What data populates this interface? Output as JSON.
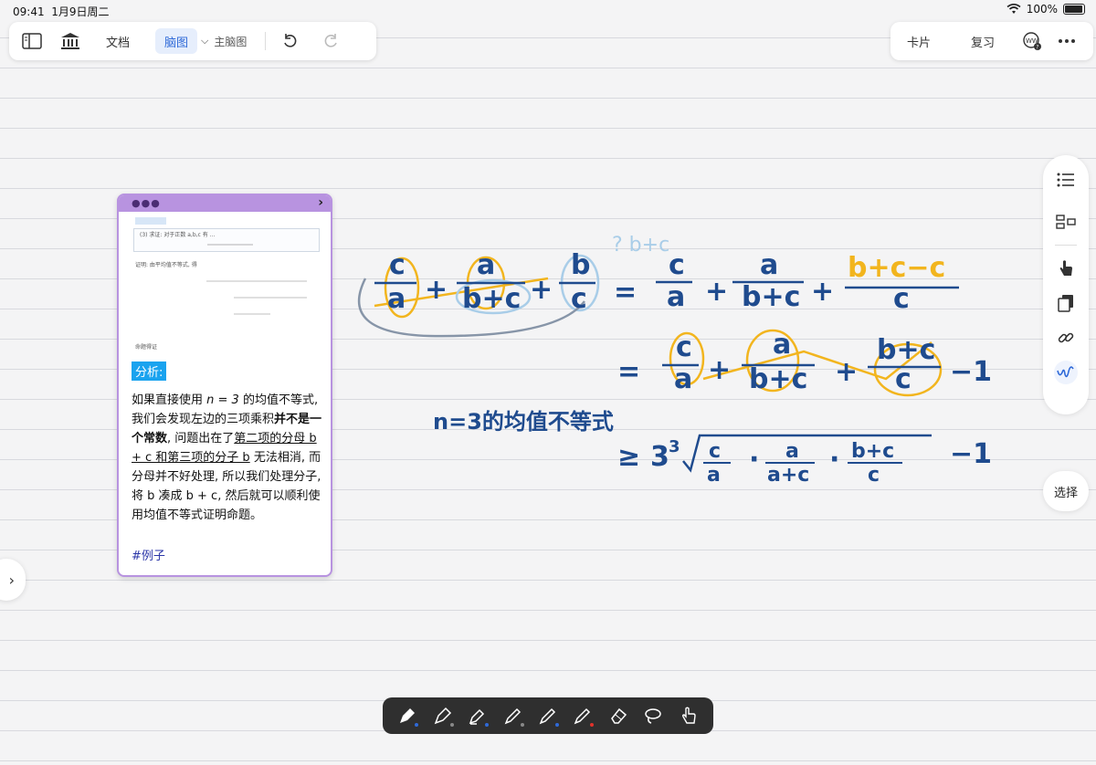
{
  "status": {
    "time": "09:41",
    "date": "1月9日周二",
    "battery": "100%"
  },
  "toolbar": {
    "doc_label": "文档",
    "mindmap_label": "脑图",
    "main_mindmap_label": "主脑图",
    "card_label": "卡片",
    "review_label": "复习"
  },
  "card": {
    "analysis_label": "分析:",
    "text_1": "如果直接使用 ",
    "text_n3": "n = 3",
    "text_2": " 的均值不等式, 我们会发现左边的三项乘积",
    "text_bold": "并不是一个常数",
    "text_3": ", 问题出在了",
    "text_underline": "第二项的分母 b + c 和第三项的分子 b",
    "text_4": " 无法相消, 而分母并不好处理, 所以我们处理分子, 将 b 凑成 b + c, 然后就可以顺利使用均值不等式证明命题。",
    "hashtag": "#例子",
    "thumb_line1": "(3) 求证: 对于正数 a,b,c 有 ...",
    "thumb_line2": "证明: 由平均值不等式, 得",
    "thumb_line3": "命题得证"
  },
  "canvas": {
    "annotation": "? b+c",
    "caption": "n=3的均值不等式"
  },
  "sidebar": {
    "select_label": "选择"
  },
  "colors": {
    "accent": "#2f6ad8",
    "card_border": "#b893e0",
    "ink": "#1f4b8e",
    "highlight": "#f2b51e",
    "tag_blue": "#1aa3ef"
  }
}
